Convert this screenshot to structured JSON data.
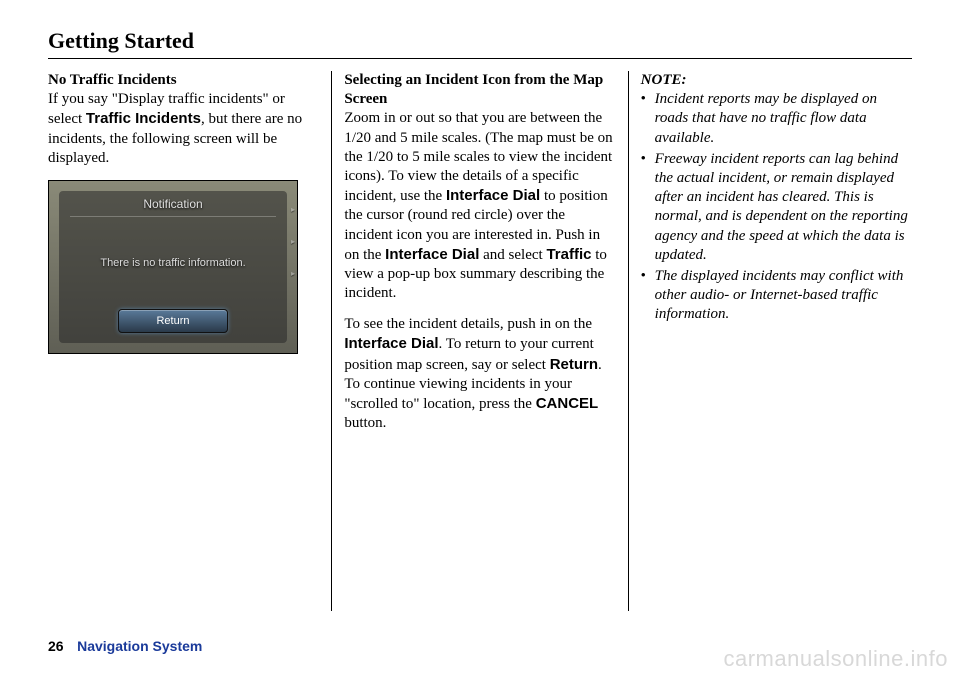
{
  "page": {
    "title": "Getting Started",
    "number": "26",
    "system": "Navigation System",
    "watermark": "carmanualsonline.info"
  },
  "col1": {
    "heading": "No Traffic Incidents",
    "p1a": "If you say \"Display traffic incidents\" or select ",
    "p1b": "Traffic Incidents",
    "p1c": ", but there are no incidents, the following screen will be displayed.",
    "shot": {
      "title": "Notification",
      "msg": "There is no traffic information.",
      "btn": "Return"
    }
  },
  "col2": {
    "heading": "Selecting an Incident Icon from the Map Screen",
    "p1a": "Zoom in or out so that you are between the 1/20 and 5 mile scales. (The map must be on the 1/20 to 5 mile scales to view the incident icons). To view the details of a specific incident, use the ",
    "p1b": "Interface Dial",
    "p1c": " to position the cursor (round red circle) over the incident icon you are interested in. Push in on the ",
    "p1d": "Interface Dial",
    "p1e": " and select ",
    "p1f": "Traffic",
    "p1g": " to view a pop-up box summary describing the incident.",
    "p2a": "To see the incident details, push in on the ",
    "p2b": "Interface Dial",
    "p2c": ". To return to your current position map screen, say or select ",
    "p2d": "Return",
    "p2e": ". To continue viewing incidents in your \"scrolled to\" location, press the ",
    "p2f": "CANCEL",
    "p2g": " button."
  },
  "col3": {
    "heading": "NOTE:",
    "li1": "Incident reports may be displayed on roads that have no traffic flow data available.",
    "li2": "Freeway incident reports can lag behind the actual incident, or remain displayed after an incident has cleared. This is normal, and is dependent on the reporting agency and the speed at which the data is updated.",
    "li3": "The displayed incidents may conflict with other audio- or Internet-based traffic information."
  }
}
